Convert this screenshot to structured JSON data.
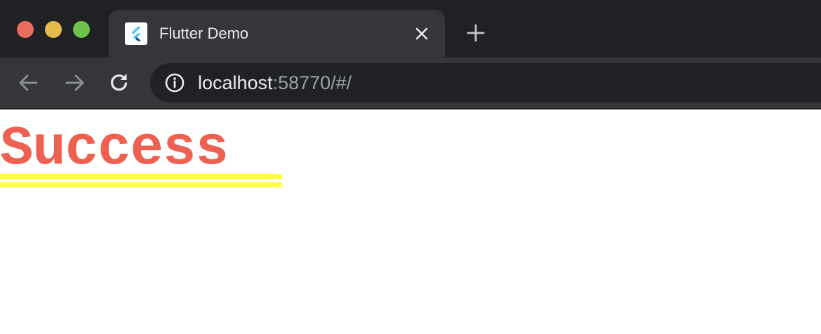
{
  "window": {
    "traffic_lights": [
      "close",
      "minimize",
      "maximize"
    ]
  },
  "tab": {
    "favicon": "flutter-logo-icon",
    "title": "Flutter Demo",
    "close_icon": "close-icon"
  },
  "new_tab": {
    "icon": "plus-icon"
  },
  "toolbar": {
    "back_icon": "arrow-left-icon",
    "forward_icon": "arrow-right-icon",
    "reload_icon": "reload-icon",
    "info_icon": "info-icon",
    "url_host": "localhost",
    "url_rest": ":58770/#/"
  },
  "page": {
    "heading": "Success",
    "heading_color": "#ee6052",
    "decoration_color": "#ffff3d"
  },
  "colors": {
    "titlebar": "#202124",
    "tab_active": "#35363a",
    "omnibox": "#202124"
  }
}
